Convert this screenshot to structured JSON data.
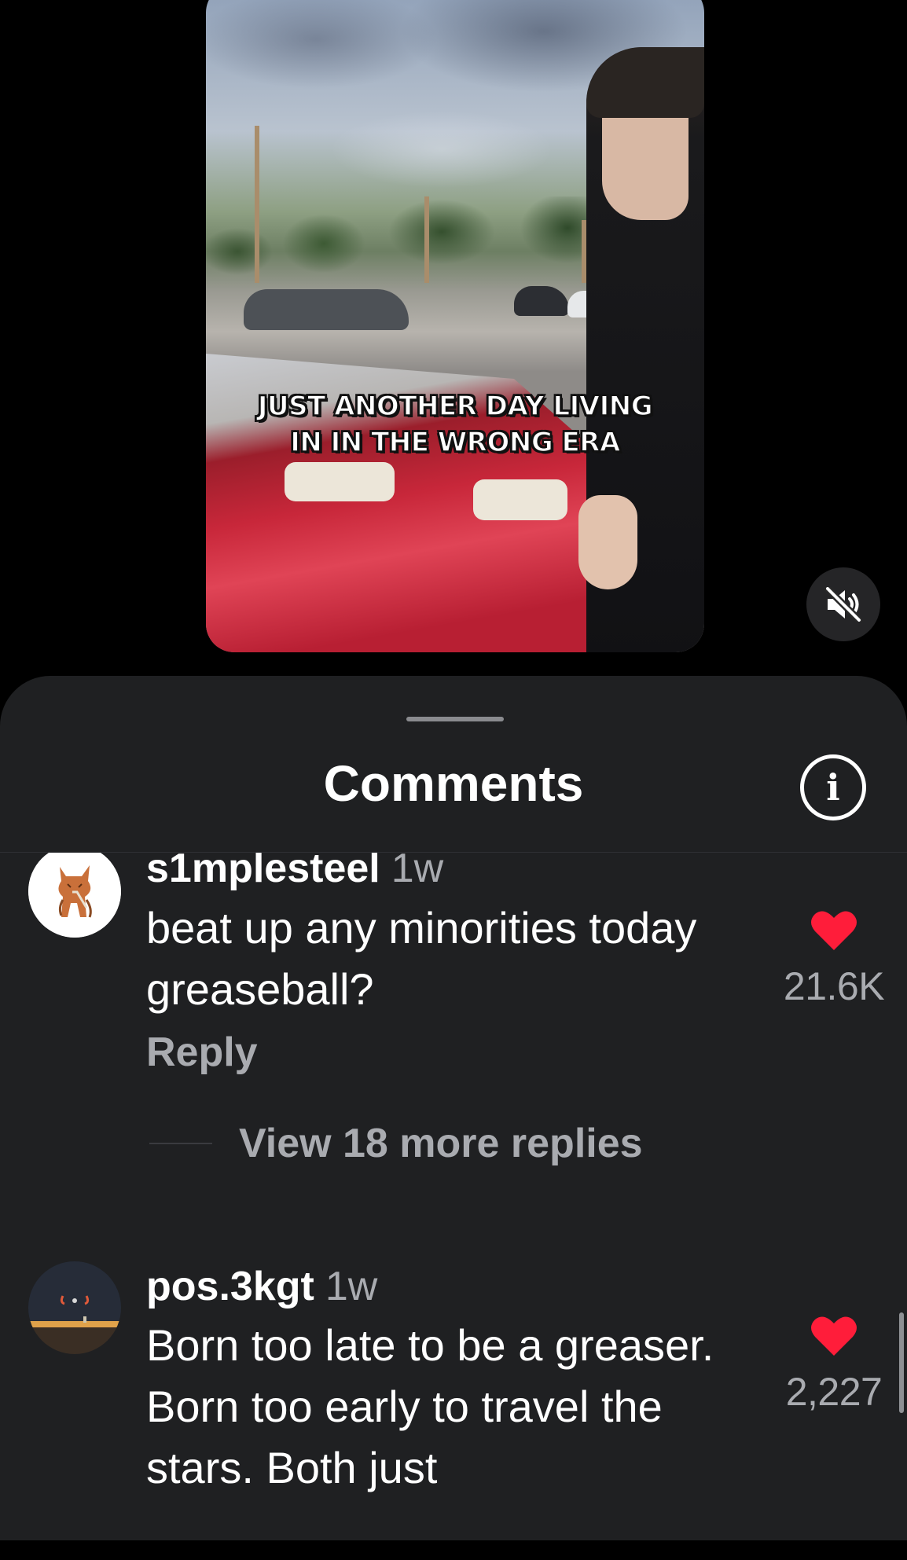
{
  "video": {
    "caption_line1": "JUST ANOTHER DAY LIVING",
    "caption_line2": "IN IN THE WRONG ERA",
    "mute_icon": "speaker-muted-icon"
  },
  "sheet": {
    "title": "Comments",
    "info_icon": "info-icon",
    "info_glyph": "i"
  },
  "comments": [
    {
      "username": "s1mplesteel",
      "time": "1w",
      "text": "beat up any minorities today greaseball?",
      "likes": "21.6K",
      "liked": true,
      "reply_label": "Reply",
      "more_replies": "View 18 more replies"
    },
    {
      "username": "pos.3kgt",
      "time": "1w",
      "text": "Born too late to be a greaser. Born too early to travel the stars. Both just",
      "likes": "2,227",
      "liked": true
    }
  ],
  "colors": {
    "sheet_bg": "#1f2022",
    "like_red": "#ff1d3a",
    "muted_text": "#a9abb0"
  }
}
